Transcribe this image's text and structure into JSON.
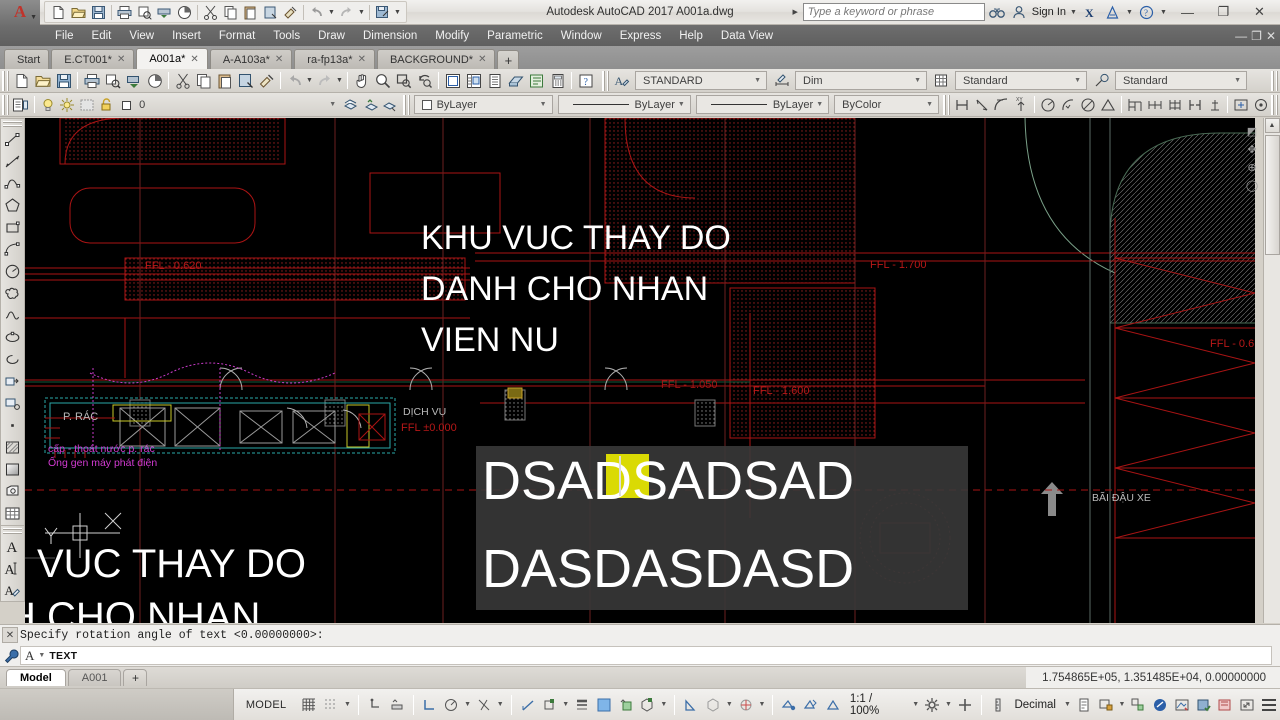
{
  "window": {
    "title": "Autodesk AutoCAD 2017   A001a.dwg",
    "app_letter": "A",
    "minimize": "—",
    "maximize": "❐",
    "close": "✕"
  },
  "quick_access": {
    "items": [
      {
        "name": "new-icon",
        "label": "New"
      },
      {
        "name": "open-icon",
        "label": "Open"
      },
      {
        "name": "save-icon",
        "label": "Save"
      },
      {
        "name": "plot-icon",
        "label": "Plot"
      },
      {
        "name": "undo-icon",
        "label": "Undo"
      },
      {
        "name": "redo-icon",
        "label": "Redo"
      },
      {
        "name": "saveas-icon",
        "label": "Save As"
      },
      {
        "name": "qat-overflow-icon",
        "label": "Customize"
      }
    ]
  },
  "infocenter": {
    "placeholder": "Type a keyword or phrase",
    "search_icon": "binoculars-icon",
    "sign_in": "Sign In",
    "exchange_icon": "autodesk-exchange-icon",
    "help_icon": "help-icon"
  },
  "menubar": {
    "items": [
      "File",
      "Edit",
      "View",
      "Insert",
      "Format",
      "Tools",
      "Draw",
      "Dimension",
      "Modify",
      "Parametric",
      "Window",
      "Express",
      "Help",
      "Data View"
    ],
    "restore": "—",
    "restore2": "❐",
    "close": "✕"
  },
  "file_tabs": {
    "tabs": [
      {
        "label": "Start",
        "closable": false,
        "active": false
      },
      {
        "label": "E.CT001*",
        "closable": true,
        "active": false
      },
      {
        "label": "A001a*",
        "closable": true,
        "active": true
      },
      {
        "label": "A-A103a*",
        "closable": true,
        "active": false
      },
      {
        "label": "ra-fp13a*",
        "closable": true,
        "active": false
      },
      {
        "label": "BACKGROUND*",
        "closable": true,
        "active": false
      }
    ],
    "add_label": "+",
    "close_glyph": "✕"
  },
  "style_toolbar": {
    "text_style": "STANDARD",
    "dim_style": "Dim",
    "table_style": "Standard",
    "mleader_style": "Standard"
  },
  "layer_toolbar": {
    "layer_name": "0",
    "color": "ByLayer",
    "linetype": "ByLayer",
    "lineweight": "ByLayer",
    "plotstyle": "ByColor"
  },
  "drawing": {
    "title_text_lines": [
      "KHU VUC THAY DO",
      "DANH CHO NHAN",
      "VIEN NU"
    ],
    "bottom_text_lines": [
      "U VUC THAY DO",
      "H CHO NHAN"
    ],
    "edit_text": {
      "line1": "DSADSADSAD",
      "line2": "DASDASDASD"
    },
    "labels": [
      {
        "text": "FFL - 0.620",
        "color": "#b81818"
      },
      {
        "text": "FFL - 1.700",
        "color": "#b81818"
      },
      {
        "text": "FFL - 1.050",
        "color": "#b81818"
      },
      {
        "text": "FFL - 1.600",
        "color": "#b81818"
      },
      {
        "text": "FFL ±0.000",
        "color": "#b81818"
      },
      {
        "text": "FFL - 0.6",
        "color": "#b81818"
      },
      {
        "text": "DỊCH VỤ",
        "color": "#d0d0d0"
      },
      {
        "text": "BÃI ĐẬU XE",
        "color": "#bfbfbf"
      },
      {
        "text": "P. RÁC",
        "color": "#c9c9c9"
      },
      {
        "text": "cấp - thoát nước p. rác",
        "color": "#d13ad1"
      },
      {
        "text": "Ống gen máy phát điện",
        "color": "#d13ad1"
      }
    ]
  },
  "command_line": {
    "history": "Specify rotation angle of text <0.00000000>:",
    "prompt_icon": "text-cursor-icon",
    "prompt": "TEXT",
    "close_glyph": "✕"
  },
  "layout_tabs": {
    "tabs": [
      {
        "label": "Model",
        "active": true
      },
      {
        "label": "A001",
        "active": false
      }
    ],
    "add_label": "+"
  },
  "status_bar": {
    "coordinates": "1.754865E+05, 1.351485E+04, 0.00000000",
    "model_label": "MODEL",
    "scale": "1:1 / 100%",
    "units": "Decimal",
    "toggles": [
      {
        "name": "grid-display-icon",
        "label": "Grid Display"
      },
      {
        "name": "snap-mode-icon",
        "label": "Snap Mode"
      },
      {
        "name": "infer-constraints-icon",
        "label": "Infer Constraints"
      },
      {
        "name": "dynamic-input-icon",
        "label": "Dynamic Input"
      },
      {
        "name": "ortho-mode-icon",
        "label": "Ortho Mode"
      },
      {
        "name": "polar-tracking-icon",
        "label": "Polar Tracking"
      },
      {
        "name": "isometric-drafting-icon",
        "label": "Isometric Drafting"
      },
      {
        "name": "object-snap-tracking-icon",
        "label": "Object Snap Tracking"
      },
      {
        "name": "object-snap-icon",
        "label": "Object Snap"
      },
      {
        "name": "lineweight-icon",
        "label": "Show/Hide Lineweight"
      },
      {
        "name": "transparency-icon",
        "label": "Show/Hide Transparency"
      },
      {
        "name": "selection-cycling-icon",
        "label": "Selection Cycling"
      },
      {
        "name": "3d-object-snap-icon",
        "label": "3D Object Snap"
      },
      {
        "name": "dynamic-ucs-icon",
        "label": "Dynamic UCS"
      },
      {
        "name": "selection-filter-icon",
        "label": "Selection Filtering"
      },
      {
        "name": "gizmo-icon",
        "label": "Gizmo"
      },
      {
        "name": "annotation-visibility-icon",
        "label": "Annotation Visibility"
      },
      {
        "name": "autoscale-icon",
        "label": "AutoScale"
      },
      {
        "name": "annotation-scale-icon",
        "label": "Annotation Scale"
      },
      {
        "name": "workspace-icon",
        "label": "Workspace Switching"
      },
      {
        "name": "annotation-monitor-icon",
        "label": "Annotation Monitor"
      },
      {
        "name": "units-icon",
        "label": "Units"
      },
      {
        "name": "quick-properties-icon",
        "label": "Quick Properties"
      },
      {
        "name": "lock-ui-icon",
        "label": "Lock UI"
      },
      {
        "name": "isolate-objects-icon",
        "label": "Isolate Objects"
      },
      {
        "name": "graphics-performance-icon",
        "label": "Graphics Performance"
      },
      {
        "name": "clean-screen-icon",
        "label": "Clean Screen"
      },
      {
        "name": "customization-icon",
        "label": "Customization"
      }
    ]
  },
  "left_toolbar": {
    "draw_tools": [
      {
        "name": "line-icon",
        "label": "Line"
      },
      {
        "name": "construction-line-icon",
        "label": "Construction Line"
      },
      {
        "name": "polyline-icon",
        "label": "Polyline"
      },
      {
        "name": "polygon-icon",
        "label": "Polygon"
      },
      {
        "name": "rectangle-icon",
        "label": "Rectangle"
      },
      {
        "name": "arc-icon",
        "label": "Arc"
      },
      {
        "name": "circle-icon",
        "label": "Circle"
      },
      {
        "name": "revision-cloud-icon",
        "label": "Revision Cloud"
      },
      {
        "name": "spline-icon",
        "label": "Spline"
      },
      {
        "name": "ellipse-icon",
        "label": "Ellipse"
      },
      {
        "name": "ellipse-arc-icon",
        "label": "Ellipse Arc"
      },
      {
        "name": "insert-block-icon",
        "label": "Insert Block"
      },
      {
        "name": "make-block-icon",
        "label": "Make Block"
      },
      {
        "name": "point-icon",
        "label": "Point"
      },
      {
        "name": "hatch-icon",
        "label": "Hatch"
      },
      {
        "name": "gradient-icon",
        "label": "Gradient"
      },
      {
        "name": "region-icon",
        "label": "Region"
      },
      {
        "name": "table-icon",
        "label": "Table"
      },
      {
        "name": "multiline-text-icon",
        "label": "Multiline Text"
      },
      {
        "name": "add-selected-icon",
        "label": "Add Selected"
      }
    ],
    "text_tools": [
      {
        "name": "single-line-text-icon",
        "label": "Single Line Text"
      },
      {
        "name": "edit-text-icon",
        "label": "Edit Text"
      },
      {
        "name": "text-style-icon",
        "label": "Text Style"
      }
    ]
  }
}
